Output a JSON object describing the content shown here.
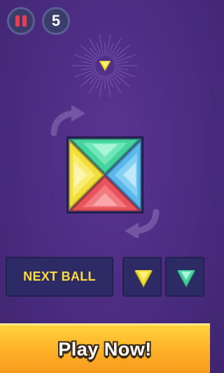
{
  "hud": {
    "pause_icon": "pause-icon",
    "level": "5"
  },
  "current_ball": {
    "color": "yellow",
    "icon": "triangle-gem-icon"
  },
  "board": {
    "pieces": [
      {
        "side": "top",
        "color": "green"
      },
      {
        "side": "right",
        "color": "blue"
      },
      {
        "side": "bottom",
        "color": "red"
      },
      {
        "side": "left",
        "color": "yellow"
      }
    ],
    "rotate_icons": [
      "rotate-clockwise-arrow-icon",
      "rotate-clockwise-arrow-icon"
    ]
  },
  "next": {
    "label": "NEXT BALL",
    "queue": [
      {
        "color": "yellow"
      },
      {
        "color": "green"
      }
    ]
  },
  "cta": {
    "label": "Play Now!"
  },
  "colors": {
    "background": "#4a2c80",
    "yellow": "#f2df3a",
    "green": "#45d39e",
    "blue": "#5bb8ea",
    "red": "#e9545c",
    "panel": "#2c2b66",
    "cta": "#ffb52a"
  }
}
